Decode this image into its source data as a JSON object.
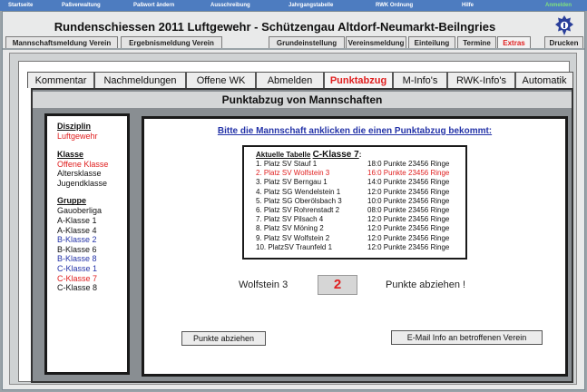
{
  "topnav": {
    "items": [
      {
        "label": "Startseite"
      },
      {
        "label": "Paßverwaltung"
      },
      {
        "label": "Paßwort ändern"
      },
      {
        "label": "Ausschreibung"
      },
      {
        "label": "Jahrgangstabelle"
      },
      {
        "label": "RWK Ordnung"
      },
      {
        "label": "Hilfe"
      }
    ],
    "login_label": "Anmelden"
  },
  "header": {
    "title": "Rundenschiessen 2011 Luftgewehr  -  Schützengau Altdorf-Neumarkt-Beilngries"
  },
  "tabs": {
    "left": [
      "Mannschaftsmeldung Verein",
      "Ergebnismeldung Verein"
    ],
    "right": [
      "Grundeinstellung",
      "Vereinsmeldung",
      "Einteilung",
      "Termine",
      "Extras"
    ],
    "print": "Drucken",
    "active": "Extras"
  },
  "page_tabs": {
    "items": [
      "Kommentar",
      "Nachmeldungen",
      "Offene WK",
      "Abmelden",
      "Punktabzug",
      "M-Info's",
      "RWK-Info's",
      "Automatik"
    ],
    "active": "Punktabzug"
  },
  "panel": {
    "title": "Punktabzug von Mannschaften"
  },
  "sidebar": {
    "disziplin": {
      "heading": "Disziplin",
      "items": [
        {
          "label": "Luftgewehr",
          "color": "red"
        }
      ]
    },
    "klasse": {
      "heading": "Klasse",
      "items": [
        {
          "label": "Offene Klasse",
          "color": "red"
        },
        {
          "label": "Altersklasse",
          "color": "black"
        },
        {
          "label": "Jugendklasse",
          "color": "black"
        }
      ]
    },
    "gruppe": {
      "heading": "Gruppe",
      "items": [
        {
          "label": "Gauoberliga",
          "color": "black"
        },
        {
          "label": "A-Klasse 1",
          "color": "black"
        },
        {
          "label": "A-Klasse 4",
          "color": "black"
        },
        {
          "label": "B-Klasse 2",
          "color": "blue"
        },
        {
          "label": "B-Klasse 6",
          "color": "black"
        },
        {
          "label": "B-Klasse 8",
          "color": "blue"
        },
        {
          "label": "C-Klasse 1",
          "color": "blue"
        },
        {
          "label": "C-Klasse 7",
          "color": "red"
        },
        {
          "label": "C-Klasse 8",
          "color": "black"
        }
      ]
    }
  },
  "content": {
    "instruction": "Bitte die Mannschaft anklicken die einen Punktabzug bekommt:",
    "table": {
      "heading_prefix": "Aktuelle  Tabelle",
      "heading_class": "C-Klasse 7",
      "heading_suffix": ":",
      "rows": [
        {
          "rank": "1. Platz SV Stauf 1",
          "punkte": "18:0 Punkte",
          "ringe": "23456 Ringe",
          "selected": false
        },
        {
          "rank": "2. Platz SV Wolfstein 3",
          "punkte": "16:0 Punkte",
          "ringe": "23456 Ringe",
          "selected": true
        },
        {
          "rank": "3. Platz SV Berngau 1",
          "punkte": "14:0 Punkte",
          "ringe": "23456 Ringe",
          "selected": false
        },
        {
          "rank": "4. Platz SG Wendelstein 1",
          "punkte": "12:0 Punkte",
          "ringe": "23456 Ringe",
          "selected": false
        },
        {
          "rank": "5. Platz SG Oberölsbach 3",
          "punkte": "10:0 Punkte",
          "ringe": "23456 Ringe",
          "selected": false
        },
        {
          "rank": "6. Platz SV Rohrenstadt 2",
          "punkte": "08:0 Punkte",
          "ringe": "23456 Ringe",
          "selected": false
        },
        {
          "rank": "7. Platz SV Pilsach 4",
          "punkte": "12:0 Punkte",
          "ringe": "23456 Ringe",
          "selected": false
        },
        {
          "rank": "8. Platz SV Möning 2",
          "punkte": "12:0 Punkte",
          "ringe": "23456 Ringe",
          "selected": false
        },
        {
          "rank": "9. Platz SV Wolfstein 2",
          "punkte": "12:0 Punkte",
          "ringe": "23456 Ringe",
          "selected": false
        },
        {
          "rank": "10. PlatzSV Traunfeld 1",
          "punkte": "12:0 Punkte",
          "ringe": "23456 Ringe",
          "selected": false
        }
      ]
    },
    "team_name": "Wolfstein 3",
    "points_value": "2",
    "points_suffix": "Punkte abziehen !",
    "btn_deduct": "Punkte abziehen",
    "btn_email": "E-Mail Info an betroffenen Verein"
  },
  "colors": {
    "nav_bar": "#4d7cc0",
    "accent_red": "#e02020",
    "link_blue": "#2433a8",
    "login_green": "#7fe07f"
  }
}
